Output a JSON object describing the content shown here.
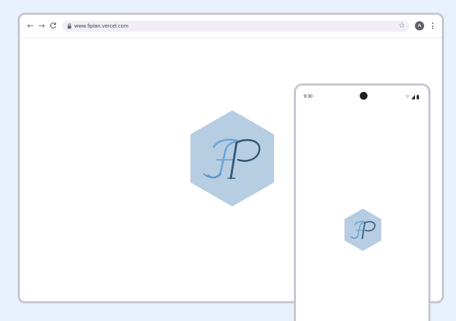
{
  "browser": {
    "url": "www.fiplan.vercel.com",
    "avatar_initial": "A",
    "nav": {
      "back_icon": "arrow-left-icon",
      "forward_icon": "arrow-right-icon",
      "reload_icon": "reload-icon"
    },
    "bookmark_icon": "star-icon",
    "menu_icon": "kebab-menu-icon"
  },
  "phone": {
    "time": "9:30",
    "status_icons": [
      "wifi-icon",
      "signal-icon",
      "battery-icon"
    ]
  },
  "logo": {
    "shape": "hexagon",
    "fill": "#b6cde2",
    "monogram_colors": [
      "#6aa3d6",
      "#3e6a8f",
      "#2f4f6c"
    ]
  }
}
